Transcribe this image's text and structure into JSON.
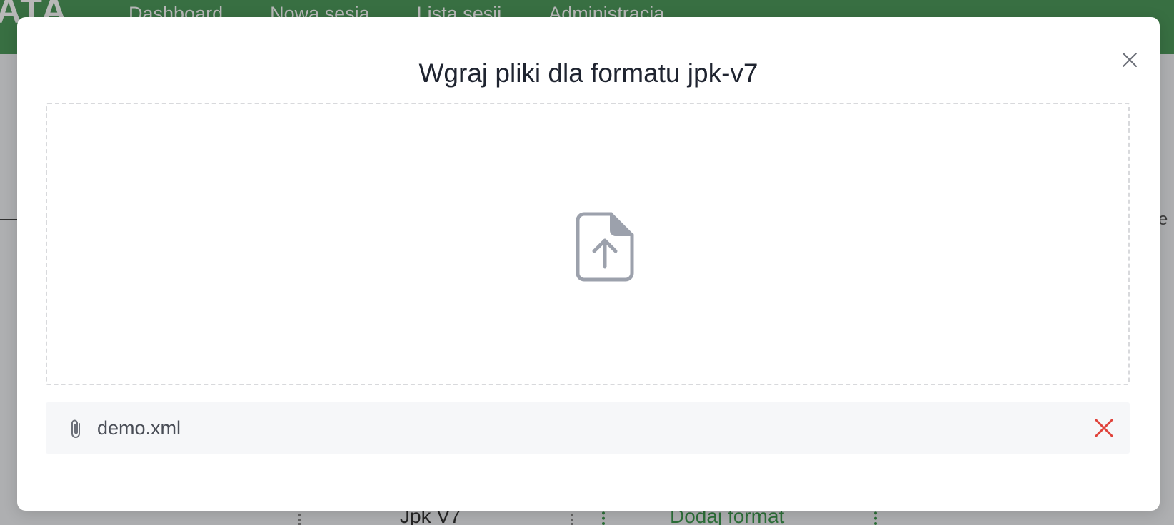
{
  "background": {
    "logo": "ATA",
    "nav": [
      "Dashboard",
      "Nowa sesja",
      "Lista sesji",
      "Administracja"
    ],
    "right_letter": "e",
    "row": {
      "name": "Jpk V7",
      "action": "Dodaj format"
    }
  },
  "modal": {
    "title": "Wgraj pliki dla formatu jpk-v7",
    "dropzone": {
      "icon": "file-upload-icon"
    },
    "files": [
      {
        "name": "demo.xml",
        "icon": "paperclip-icon",
        "remove_icon": "remove-file-icon"
      }
    ]
  },
  "colors": {
    "header": "#4e9a5c",
    "accent_green": "#3e9a4e",
    "remove_red": "#e0443c",
    "icon_gray": "#9ca1ac"
  }
}
